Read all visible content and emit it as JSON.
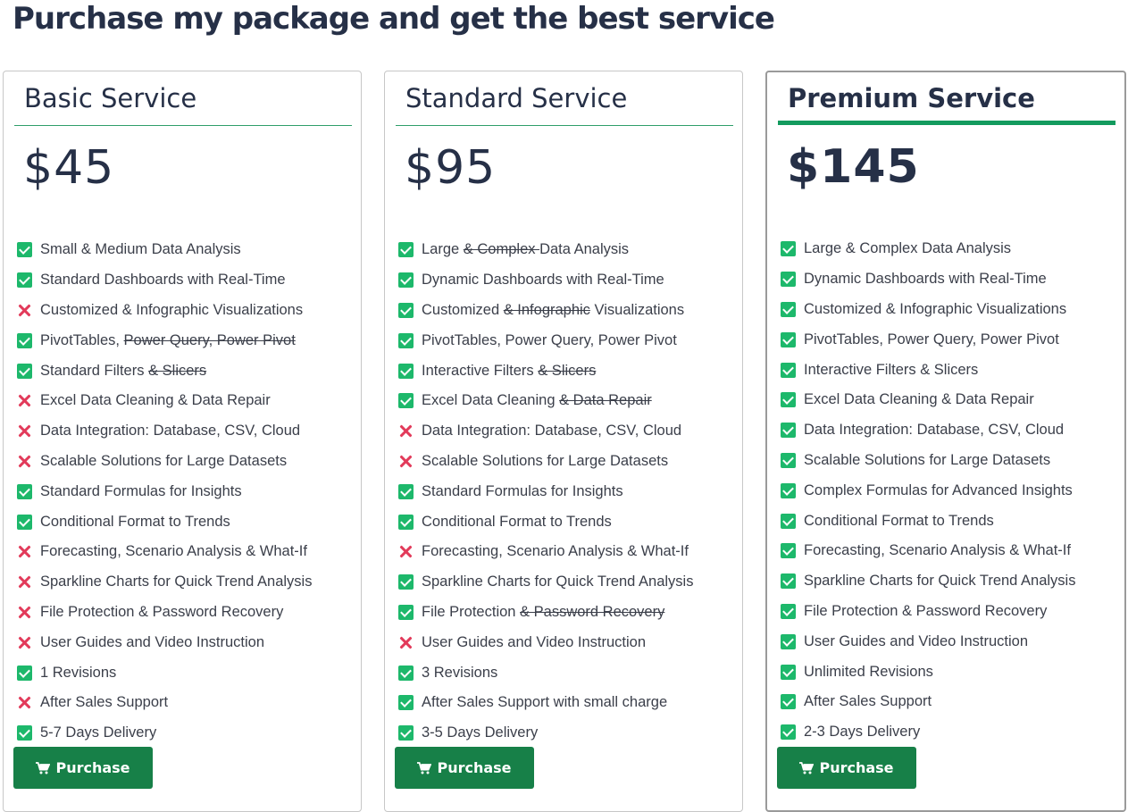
{
  "heading": "Purchase my package and get the best service",
  "plans": [
    {
      "name": "Basic Service",
      "price": "$45",
      "button_label": "Purchase",
      "features": [
        {
          "status": "check",
          "parts": [
            {
              "text": "Small & Medium Data Analysis",
              "struck": false
            }
          ]
        },
        {
          "status": "check",
          "parts": [
            {
              "text": "Standard Dashboards with Real-Time",
              "struck": false
            }
          ]
        },
        {
          "status": "cross",
          "parts": [
            {
              "text": "Customized & Infographic Visualizations",
              "struck": false
            }
          ]
        },
        {
          "status": "check",
          "parts": [
            {
              "text": "PivotTables, ",
              "struck": false
            },
            {
              "text": "Power Query, Power Pivot",
              "struck": true
            }
          ]
        },
        {
          "status": "check",
          "parts": [
            {
              "text": "Standard Filters ",
              "struck": false
            },
            {
              "text": "& Slicers",
              "struck": true
            }
          ]
        },
        {
          "status": "cross",
          "parts": [
            {
              "text": "Excel Data Cleaning & Data Repair",
              "struck": false
            }
          ]
        },
        {
          "status": "cross",
          "parts": [
            {
              "text": "Data Integration: Database, CSV, Cloud",
              "struck": false
            }
          ]
        },
        {
          "status": "cross",
          "parts": [
            {
              "text": "Scalable Solutions for Large Datasets",
              "struck": false
            }
          ]
        },
        {
          "status": "check",
          "parts": [
            {
              "text": "Standard Formulas for Insights",
              "struck": false
            }
          ]
        },
        {
          "status": "check",
          "parts": [
            {
              "text": "Conditional Format to Trends",
              "struck": false
            }
          ]
        },
        {
          "status": "cross",
          "parts": [
            {
              "text": "Forecasting, Scenario Analysis & What-If",
              "struck": false
            }
          ]
        },
        {
          "status": "cross",
          "parts": [
            {
              "text": "Sparkline Charts for Quick Trend Analysis",
              "struck": false
            }
          ]
        },
        {
          "status": "cross",
          "parts": [
            {
              "text": "File Protection & Password Recovery",
              "struck": false
            }
          ]
        },
        {
          "status": "cross",
          "parts": [
            {
              "text": "User Guides and Video Instruction",
              "struck": false
            }
          ]
        },
        {
          "status": "check",
          "parts": [
            {
              "text": "1 Revisions",
              "struck": false
            }
          ]
        },
        {
          "status": "cross",
          "parts": [
            {
              "text": "After Sales Support",
              "struck": false
            }
          ]
        },
        {
          "status": "check",
          "parts": [
            {
              "text": "5-7 Days Delivery",
              "struck": false
            }
          ]
        }
      ]
    },
    {
      "name": "Standard Service",
      "price": "$95",
      "button_label": "Purchase",
      "features": [
        {
          "status": "check",
          "parts": [
            {
              "text": "Large ",
              "struck": false
            },
            {
              "text": "& Complex ",
              "struck": true
            },
            {
              "text": "Data Analysis",
              "struck": false
            }
          ]
        },
        {
          "status": "check",
          "parts": [
            {
              "text": "Dynamic Dashboards with Real-Time",
              "struck": false
            }
          ]
        },
        {
          "status": "check",
          "parts": [
            {
              "text": "Customized ",
              "struck": false
            },
            {
              "text": "& Infographic",
              "struck": true
            },
            {
              "text": " Visualizations",
              "struck": false
            }
          ]
        },
        {
          "status": "check",
          "parts": [
            {
              "text": "PivotTables, Power Query, Power Pivot",
              "struck": false
            }
          ]
        },
        {
          "status": "check",
          "parts": [
            {
              "text": "Interactive Filters ",
              "struck": false
            },
            {
              "text": "& Slicers",
              "struck": true
            }
          ]
        },
        {
          "status": "check",
          "parts": [
            {
              "text": "Excel Data Cleaning ",
              "struck": false
            },
            {
              "text": "& Data Repair",
              "struck": true
            }
          ]
        },
        {
          "status": "cross",
          "parts": [
            {
              "text": "Data Integration: Database, CSV, Cloud",
              "struck": false
            }
          ]
        },
        {
          "status": "cross",
          "parts": [
            {
              "text": "Scalable Solutions for Large Datasets",
              "struck": false
            }
          ]
        },
        {
          "status": "check",
          "parts": [
            {
              "text": "Standard Formulas for Insights",
              "struck": false
            }
          ]
        },
        {
          "status": "check",
          "parts": [
            {
              "text": "Conditional Format to Trends",
              "struck": false
            }
          ]
        },
        {
          "status": "cross",
          "parts": [
            {
              "text": "Forecasting, Scenario Analysis & What-If",
              "struck": false
            }
          ]
        },
        {
          "status": "check",
          "parts": [
            {
              "text": "Sparkline Charts for Quick Trend Analysis",
              "struck": false
            }
          ]
        },
        {
          "status": "check",
          "parts": [
            {
              "text": "File Protection ",
              "struck": false
            },
            {
              "text": "& Password Recovery",
              "struck": true
            }
          ]
        },
        {
          "status": "cross",
          "parts": [
            {
              "text": "User Guides and Video Instruction",
              "struck": false
            }
          ]
        },
        {
          "status": "check",
          "parts": [
            {
              "text": "3 Revisions",
              "struck": false
            }
          ]
        },
        {
          "status": "check",
          "parts": [
            {
              "text": "After Sales Support with small charge",
              "struck": false
            }
          ]
        },
        {
          "status": "check",
          "parts": [
            {
              "text": "3-5 Days Delivery",
              "struck": false
            }
          ]
        }
      ]
    },
    {
      "name": "Premium Service",
      "price": "$145",
      "button_label": "Purchase",
      "features": [
        {
          "status": "check",
          "parts": [
            {
              "text": "Large & Complex Data Analysis",
              "struck": false
            }
          ]
        },
        {
          "status": "check",
          "parts": [
            {
              "text": "Dynamic Dashboards with Real-Time",
              "struck": false
            }
          ]
        },
        {
          "status": "check",
          "parts": [
            {
              "text": "Customized & Infographic Visualizations",
              "struck": false
            }
          ]
        },
        {
          "status": "check",
          "parts": [
            {
              "text": "PivotTables, Power Query, Power Pivot",
              "struck": false
            }
          ]
        },
        {
          "status": "check",
          "parts": [
            {
              "text": "Interactive Filters & Slicers",
              "struck": false
            }
          ]
        },
        {
          "status": "check",
          "parts": [
            {
              "text": "Excel Data Cleaning & Data Repair",
              "struck": false
            }
          ]
        },
        {
          "status": "check",
          "parts": [
            {
              "text": "Data Integration: Database, CSV, Cloud",
              "struck": false
            }
          ]
        },
        {
          "status": "check",
          "parts": [
            {
              "text": "Scalable Solutions for Large Datasets",
              "struck": false
            }
          ]
        },
        {
          "status": "check",
          "parts": [
            {
              "text": "Complex Formulas for Advanced Insights",
              "struck": false
            }
          ]
        },
        {
          "status": "check",
          "parts": [
            {
              "text": "Conditional Format to Trends",
              "struck": false
            }
          ]
        },
        {
          "status": "check",
          "parts": [
            {
              "text": "Forecasting, Scenario Analysis & What-If",
              "struck": false
            }
          ]
        },
        {
          "status": "check",
          "parts": [
            {
              "text": "Sparkline Charts for Quick Trend Analysis",
              "struck": false
            }
          ]
        },
        {
          "status": "check",
          "parts": [
            {
              "text": "File Protection & Password Recovery",
              "struck": false
            }
          ]
        },
        {
          "status": "check",
          "parts": [
            {
              "text": "User Guides and Video Instruction",
              "struck": false
            }
          ]
        },
        {
          "status": "check",
          "parts": [
            {
              "text": "Unlimited Revisions",
              "struck": false
            }
          ]
        },
        {
          "status": "check",
          "parts": [
            {
              "text": "After Sales Support",
              "struck": false
            }
          ]
        },
        {
          "status": "check",
          "parts": [
            {
              "text": "2-3 Days Delivery",
              "struck": false
            }
          ]
        }
      ]
    }
  ],
  "icons": {
    "included": "check-icon",
    "excluded": "cross-icon",
    "button": "cart-icon"
  },
  "colors": {
    "heading": "#263047",
    "check": "#1db86b",
    "cross": "#e23a5a",
    "button": "#178048",
    "accent_rule": "#139b5e"
  }
}
